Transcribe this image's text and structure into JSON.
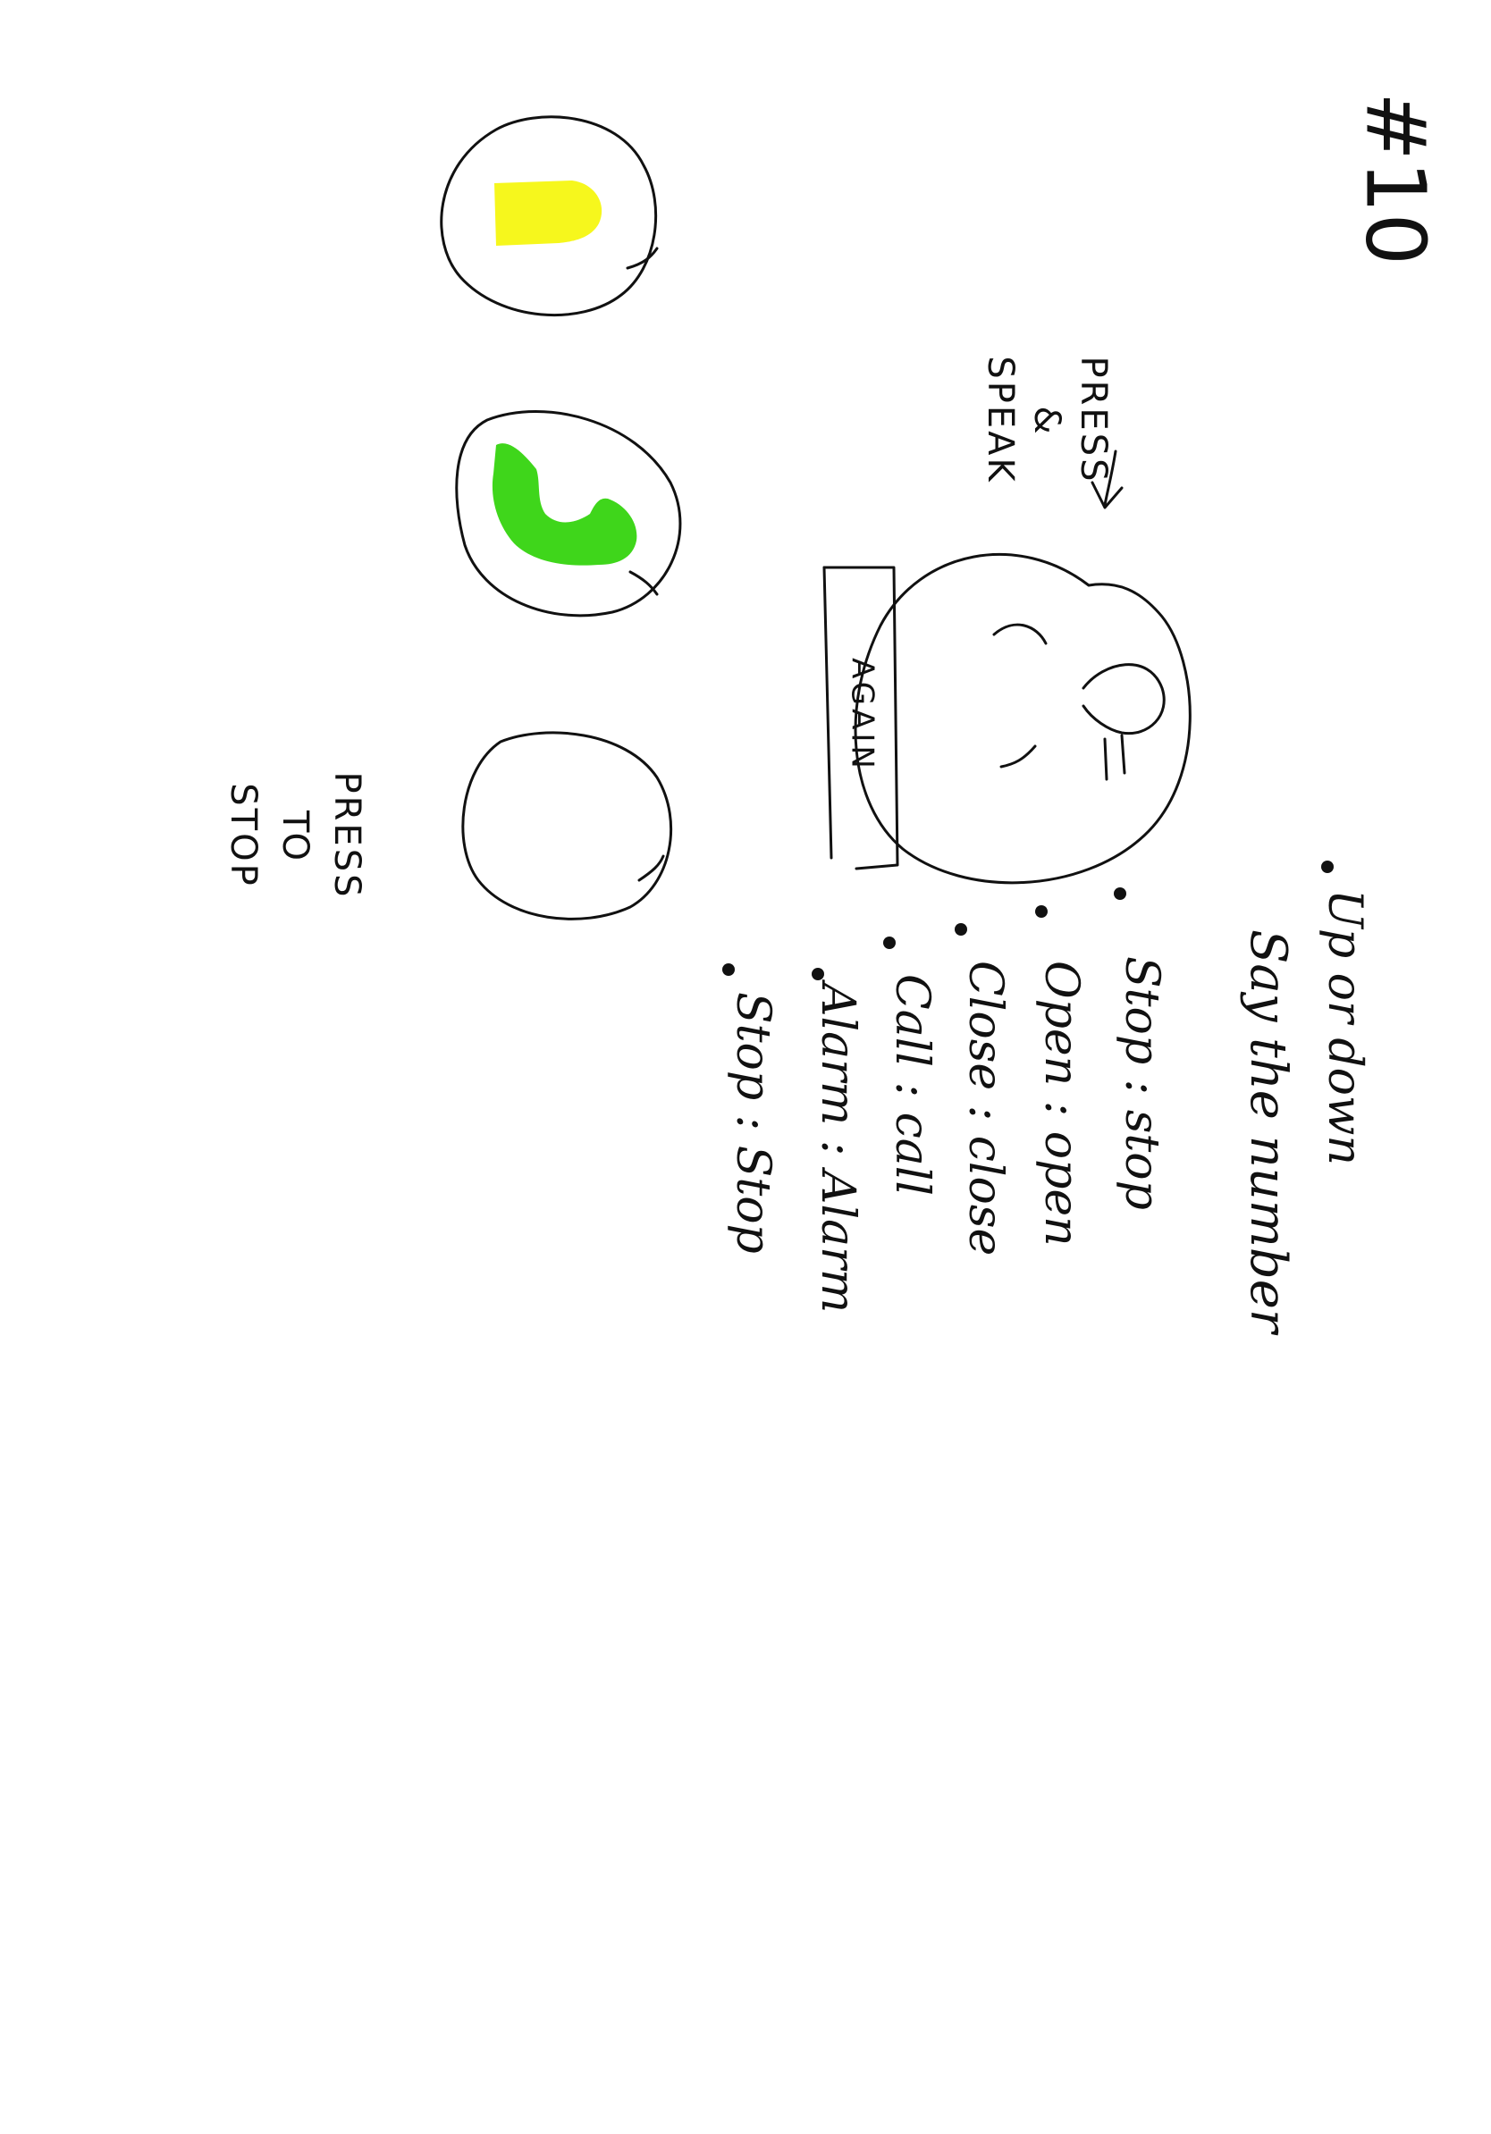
{
  "sketch": {
    "page_number": "#10",
    "press_speak": {
      "line1": "PRESS",
      "line2": "&",
      "line3": "SPEAK"
    },
    "again_label": "AGAIN",
    "press_stop": {
      "line1": "PRESS",
      "line2": "TO",
      "line3": "STOP"
    },
    "commands": [
      "Up or down",
      "Say the number",
      "Stop : stop",
      "Open : open",
      "Close : close",
      "Call : call",
      "Alarm : Alarm",
      "Stop : Stop"
    ],
    "colors": {
      "ink": "#111111",
      "yellow_fill": "#f6f71d",
      "green_fill": "#3fd61b"
    },
    "icons": {
      "yellow_button": "yellow-bell-shape",
      "green_button": "green-phone-handset",
      "mic_button": "microphone-with-waves",
      "stop_button": "empty-circle"
    }
  }
}
